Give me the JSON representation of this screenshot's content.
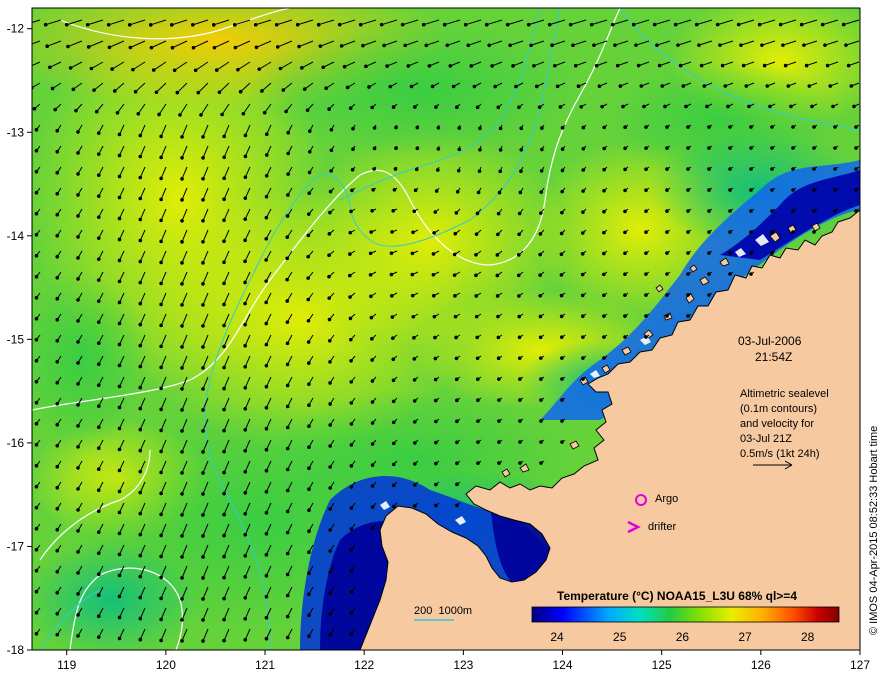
{
  "map": {
    "x_ticks": [
      "119",
      "120",
      "121",
      "122",
      "123",
      "124",
      "125",
      "126",
      "127"
    ],
    "y_ticks": [
      "-12",
      "-13",
      "-14",
      "-15",
      "-16",
      "-17",
      "-18"
    ],
    "x_range": [
      118.65,
      127.0
    ],
    "y_range": [
      -18.0,
      -11.8
    ]
  },
  "annotation": {
    "date": "03-Jul-2006",
    "time": "21:54Z",
    "altimetry_lines": [
      "Altimetric sealevel",
      "(0.1m contours)",
      "and velocity for",
      "03-Jul 21Z",
      "0.5m/s (1kt 24h)"
    ]
  },
  "legend": {
    "argo": "Argo",
    "drifter": "drifter",
    "depth_label": "200  1000m",
    "colorbar_title": "Temperature (°C) NOAA15_L3U 68% ql>=4",
    "colorbar_ticks": [
      "24",
      "25",
      "26",
      "27",
      "28"
    ],
    "colorbar_range": [
      23.6,
      28.5
    ]
  },
  "credit": "© IMOS 04-Apr-2015 08:52:33 Hobart time",
  "colors": {
    "land": "#f7c9a0",
    "argo_marker": "#e000e0",
    "drifter_marker": "#e000e0",
    "depth_contour": "#33cccc",
    "sealevel_contour": "#ffffff",
    "colormap": [
      "#000080",
      "#0000ff",
      "#00aaff",
      "#00e0c0",
      "#22cc44",
      "#88e000",
      "#e8ee00",
      "#ffb000",
      "#ff5000",
      "#cc0000",
      "#800000"
    ]
  }
}
